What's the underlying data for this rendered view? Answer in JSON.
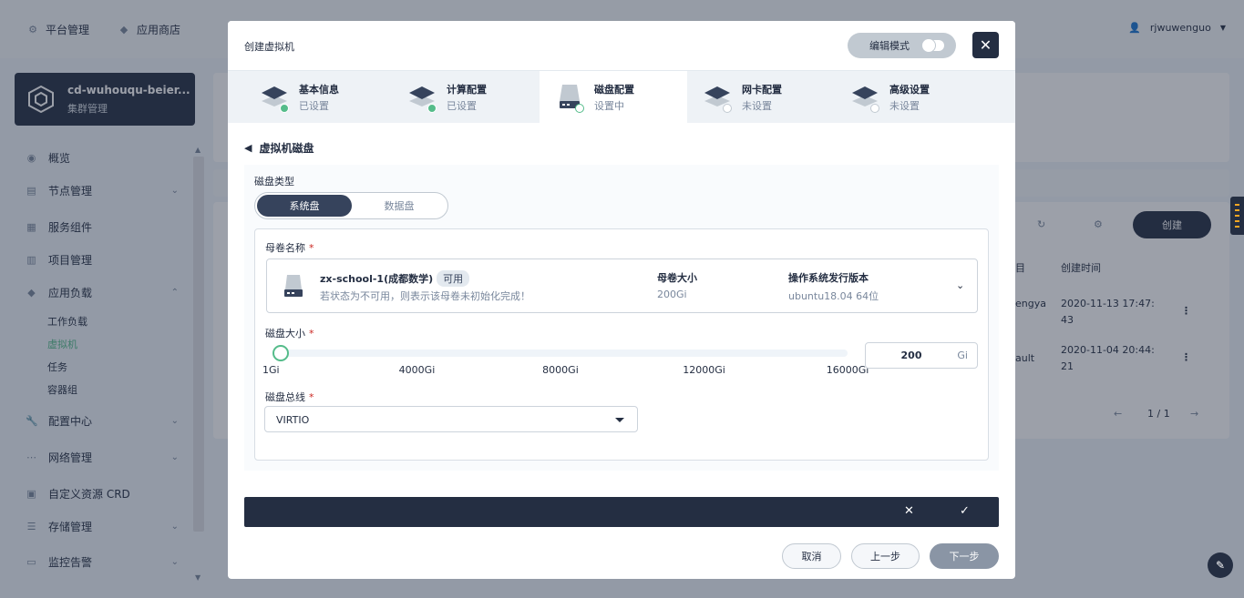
{
  "topnav": {
    "platform": "平台管理",
    "appstore": "应用商店",
    "user": "rjwuwenguo"
  },
  "sidebar": {
    "cluster_name": "cd-wuhouqu-beier...",
    "cluster_sub": "集群管理",
    "items": [
      {
        "label": "概览"
      },
      {
        "label": "节点管理"
      },
      {
        "label": "服务组件"
      },
      {
        "label": "项目管理"
      },
      {
        "label": "应用负载"
      },
      {
        "label": "配置中心"
      },
      {
        "label": "网络管理"
      },
      {
        "label": "自定义资源 CRD"
      },
      {
        "label": "存储管理"
      },
      {
        "label": "监控告警"
      }
    ],
    "subitems": [
      "工作负载",
      "虚拟机",
      "任务",
      "容器组"
    ]
  },
  "background": {
    "create_label": "创建",
    "col_created": "创建时间",
    "col_partial": "目",
    "row1_partial": "engya",
    "row1_time_a": "2020-11-13 17:47:",
    "row1_time_b": "43",
    "row2_partial": "ault",
    "row2_time_a": "2020-11-04 20:44:",
    "row2_time_b": "21",
    "pagination": "1 / 1"
  },
  "modal": {
    "title": "创建虚拟机",
    "edit_mode": "编辑模式",
    "steps": [
      {
        "title": "基本信息",
        "status": "已设置",
        "state": "done"
      },
      {
        "title": "计算配置",
        "status": "已设置",
        "state": "done"
      },
      {
        "title": "磁盘配置",
        "status": "设置中",
        "state": "current"
      },
      {
        "title": "网卡配置",
        "status": "未设置",
        "state": "todo"
      },
      {
        "title": "高级设置",
        "status": "未设置",
        "state": "todo"
      }
    ],
    "section_title": "虚拟机磁盘",
    "disk_type_label": "磁盘类型",
    "disk_type_options": [
      "系统盘",
      "数据盘"
    ],
    "volume_label": "母卷名称",
    "volume": {
      "name": "zx-school-1(成都数学)",
      "tag": "可用",
      "desc": "若状态为不可用，则表示该母卷未初始化完成！",
      "size_label": "母卷大小",
      "size_value": "200Gi",
      "os_label": "操作系统发行版本",
      "os_value": "ubuntu18.04 64位"
    },
    "disk_size_label": "磁盘大小",
    "slider": {
      "min": 1,
      "max": 16000,
      "value": 200,
      "ticks": [
        "1Gi",
        "4000Gi",
        "8000Gi",
        "12000Gi",
        "16000Gi"
      ],
      "tick_values": [
        1,
        4000,
        8000,
        12000,
        16000
      ]
    },
    "size_input": {
      "value": "200",
      "unit": "Gi"
    },
    "bus_label": "磁盘总线",
    "bus_value": "VIRTIO",
    "buttons": {
      "cancel": "取消",
      "prev": "上一步",
      "next": "下一步"
    }
  },
  "colors": {
    "accent": "#55bc8a",
    "dark": "#242e42"
  }
}
